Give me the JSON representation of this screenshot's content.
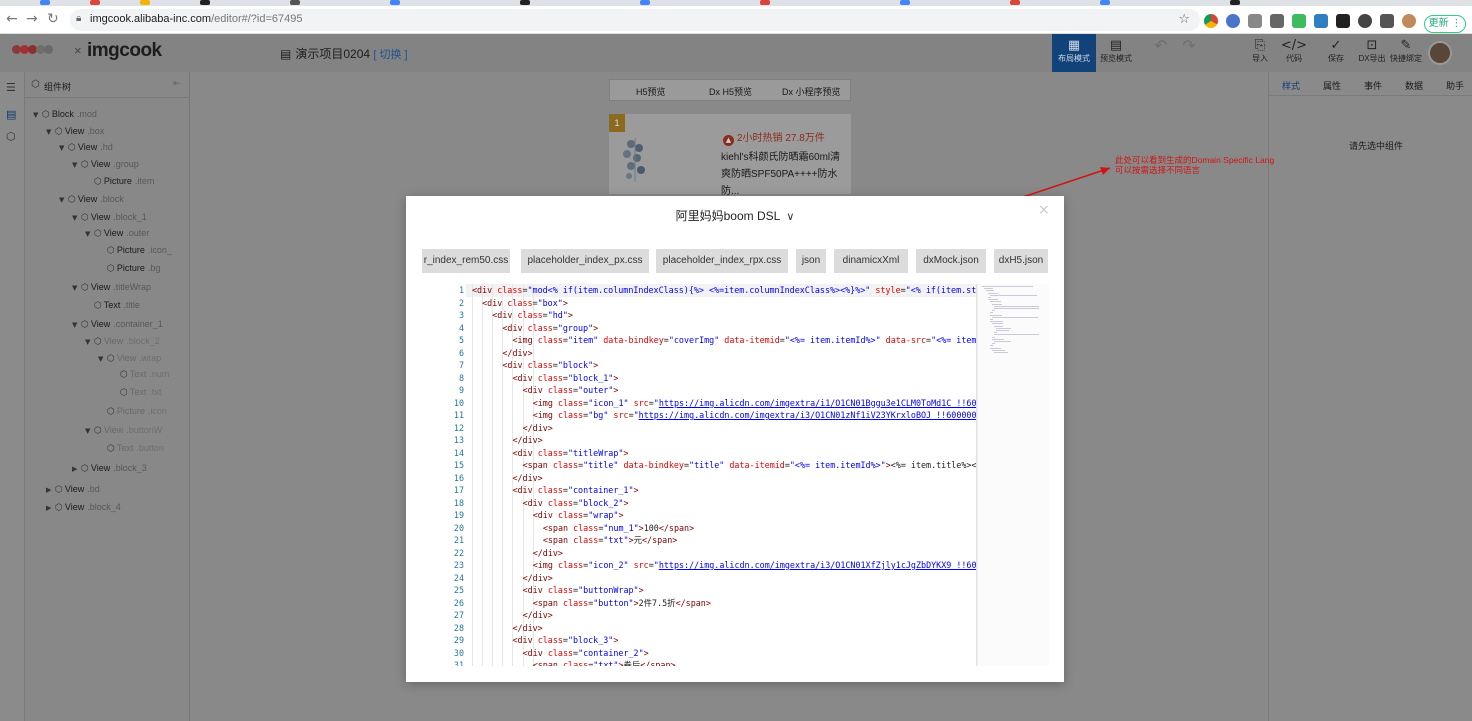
{
  "browser": {
    "url_host": "imgcook.alibaba-inc.com",
    "url_path": "/editor#/?id=67495",
    "update_label": "更新",
    "update_dots": "⋮"
  },
  "app": {
    "logo_text": "imgcook",
    "logo_x": "×",
    "project_name": "演示项目0204",
    "switch_label": "[ 切换 ]",
    "header_buttons": [
      {
        "label": "布局模式",
        "icon": "layout-icon"
      },
      {
        "label": "预览模式",
        "icon": "preview-icon"
      },
      {
        "label": "导入",
        "icon": "import-icon"
      },
      {
        "label": "代码",
        "icon": "code-icon"
      },
      {
        "label": "保存",
        "icon": "save-icon"
      },
      {
        "label": "DX导出",
        "icon": "export-icon"
      },
      {
        "label": "快捷绑定",
        "icon": "bind-icon"
      }
    ]
  },
  "tree": {
    "title": "组件树",
    "rows": [
      {
        "name": "Block",
        "cls": ".mod"
      },
      {
        "name": "View",
        "cls": ".box"
      },
      {
        "name": "View",
        "cls": ".hd"
      },
      {
        "name": "View",
        "cls": ".group"
      },
      {
        "name": "Picture",
        "cls": ".item"
      },
      {
        "name": "View",
        "cls": ".block"
      },
      {
        "name": "View",
        "cls": ".block_1"
      },
      {
        "name": "View",
        "cls": ".outer"
      },
      {
        "name": "Picture",
        "cls": ".icon_"
      },
      {
        "name": "Picture",
        "cls": ".bg"
      },
      {
        "name": "View",
        "cls": ".titleWrap"
      },
      {
        "name": "Text",
        "cls": ".title"
      },
      {
        "name": "View",
        "cls": ".container_1"
      },
      {
        "name": "View",
        "cls": ".block_2"
      },
      {
        "name": "View",
        "cls": ".wrap"
      },
      {
        "name": "Text",
        "cls": ".num"
      },
      {
        "name": "Text",
        "cls": ".txt"
      },
      {
        "name": "Picture",
        "cls": ".icon"
      },
      {
        "name": "View",
        "cls": ".buttonW"
      },
      {
        "name": "Text",
        "cls": ".button"
      },
      {
        "name": "View",
        "cls": ".block_3"
      },
      {
        "name": "View",
        "cls": ".bd"
      },
      {
        "name": "View",
        "cls": ".block_4"
      }
    ]
  },
  "preview": {
    "tabs": [
      "H5预览",
      "Dx H5预览",
      "Dx 小程序预览"
    ],
    "badge": "1",
    "hot": "2小时热销 27.8万件",
    "title": "kiehl's科颜氏防晒霜60ml清爽防晒SPF50PA++++防水防..."
  },
  "right_panel": {
    "tabs": [
      "样式",
      "属性",
      "事件",
      "数据",
      "助手"
    ],
    "empty": "请先选中组件"
  },
  "annotation": {
    "text": "此处可以看到生成的Domain Specific Lang 可以按需选择不同语言"
  },
  "modal": {
    "title": "阿里妈妈boom DSL",
    "close": "×",
    "file_tabs": [
      "r_index_rem50.css",
      "placeholder_index_px.css",
      "placeholder_index_rpx.css",
      "json",
      "dinamicxXml",
      "dxMock.json",
      "dxH5.json"
    ],
    "code_lines": [
      [
        [
          "t",
          "<div "
        ],
        [
          "a",
          "class"
        ],
        [
          "p",
          "="
        ],
        [
          "v",
          "\"mod<% if(item.columnIndexClass){%> <%=item.columnIndexClass%><%}%>\""
        ],
        [
          "p",
          " "
        ],
        [
          "a",
          "style"
        ],
        [
          "p",
          "="
        ],
        [
          "v",
          "\"<% if(item.styl"
        ]
      ],
      [
        [
          "t",
          "<div "
        ],
        [
          "a",
          "class"
        ],
        [
          "p",
          "="
        ],
        [
          "v",
          "\"box\""
        ],
        [
          "t",
          ">"
        ]
      ],
      [
        [
          "t",
          "<div "
        ],
        [
          "a",
          "class"
        ],
        [
          "p",
          "="
        ],
        [
          "v",
          "\"hd\""
        ],
        [
          "t",
          ">"
        ]
      ],
      [
        [
          "t",
          "<div "
        ],
        [
          "a",
          "class"
        ],
        [
          "p",
          "="
        ],
        [
          "v",
          "\"group\""
        ],
        [
          "t",
          ">"
        ]
      ],
      [
        [
          "t",
          "<img "
        ],
        [
          "a",
          "class"
        ],
        [
          "p",
          "="
        ],
        [
          "v",
          "\"item\""
        ],
        [
          "p",
          " "
        ],
        [
          "a",
          "data-bindkey"
        ],
        [
          "p",
          "="
        ],
        [
          "v",
          "\"coverImg\""
        ],
        [
          "p",
          " "
        ],
        [
          "a",
          "data-itemid"
        ],
        [
          "p",
          "="
        ],
        [
          "v",
          "\"<%= item.itemId%>\""
        ],
        [
          "p",
          " "
        ],
        [
          "a",
          "data-src"
        ],
        [
          "p",
          "="
        ],
        [
          "v",
          "\"<%= item.c"
        ]
      ],
      [
        [
          "t",
          "</div>"
        ]
      ],
      [
        [
          "t",
          "<div "
        ],
        [
          "a",
          "class"
        ],
        [
          "p",
          "="
        ],
        [
          "v",
          "\"block\""
        ],
        [
          "t",
          ">"
        ]
      ],
      [
        [
          "t",
          "<div "
        ],
        [
          "a",
          "class"
        ],
        [
          "p",
          "="
        ],
        [
          "v",
          "\"block_1\""
        ],
        [
          "t",
          ">"
        ]
      ],
      [
        [
          "t",
          "<div "
        ],
        [
          "a",
          "class"
        ],
        [
          "p",
          "="
        ],
        [
          "v",
          "\"outer\""
        ],
        [
          "t",
          ">"
        ]
      ],
      [
        [
          "t",
          "<img "
        ],
        [
          "a",
          "class"
        ],
        [
          "p",
          "="
        ],
        [
          "v",
          "\"icon_1\""
        ],
        [
          "p",
          " "
        ],
        [
          "a",
          "src"
        ],
        [
          "p",
          "="
        ],
        [
          "v",
          "\""
        ],
        [
          "u",
          "https://img.alicdn.com/imgextra/i1/O1CN01Bggu3e1CLM0ToMd1C_!!6000"
        ]
      ],
      [
        [
          "t",
          "<img "
        ],
        [
          "a",
          "class"
        ],
        [
          "p",
          "="
        ],
        [
          "v",
          "\"bg\""
        ],
        [
          "p",
          " "
        ],
        [
          "a",
          "src"
        ],
        [
          "p",
          "="
        ],
        [
          "v",
          "\""
        ],
        [
          "u",
          "https://img.alicdn.com/imgextra/i3/O1CN01zNf1iV23YKrxloBOJ_!!60000000"
        ]
      ],
      [
        [
          "t",
          "</div>"
        ]
      ],
      [
        [
          "t",
          "</div>"
        ]
      ],
      [
        [
          "t",
          "<div "
        ],
        [
          "a",
          "class"
        ],
        [
          "p",
          "="
        ],
        [
          "v",
          "\"titleWrap\""
        ],
        [
          "t",
          ">"
        ]
      ],
      [
        [
          "t",
          "<span "
        ],
        [
          "a",
          "class"
        ],
        [
          "p",
          "="
        ],
        [
          "v",
          "\"title\""
        ],
        [
          "p",
          " "
        ],
        [
          "a",
          "data-bindkey"
        ],
        [
          "p",
          "="
        ],
        [
          "v",
          "\"title\""
        ],
        [
          "p",
          " "
        ],
        [
          "a",
          "data-itemid"
        ],
        [
          "p",
          "="
        ],
        [
          "v",
          "\"<%= item.itemId%>\""
        ],
        [
          "t",
          ">"
        ],
        [
          "p",
          "<%= item.title%></s"
        ]
      ],
      [
        [
          "t",
          "</div>"
        ]
      ],
      [
        [
          "t",
          "<div "
        ],
        [
          "a",
          "class"
        ],
        [
          "p",
          "="
        ],
        [
          "v",
          "\"container_1\""
        ],
        [
          "t",
          ">"
        ]
      ],
      [
        [
          "t",
          "<div "
        ],
        [
          "a",
          "class"
        ],
        [
          "p",
          "="
        ],
        [
          "v",
          "\"block_2\""
        ],
        [
          "t",
          ">"
        ]
      ],
      [
        [
          "t",
          "<div "
        ],
        [
          "a",
          "class"
        ],
        [
          "p",
          "="
        ],
        [
          "v",
          "\"wrap\""
        ],
        [
          "t",
          ">"
        ]
      ],
      [
        [
          "t",
          "<span "
        ],
        [
          "a",
          "class"
        ],
        [
          "p",
          "="
        ],
        [
          "v",
          "\"num_1\""
        ],
        [
          "t",
          ">"
        ],
        [
          "p",
          "100"
        ],
        [
          "t",
          "</span>"
        ]
      ],
      [
        [
          "t",
          "<span "
        ],
        [
          "a",
          "class"
        ],
        [
          "p",
          "="
        ],
        [
          "v",
          "\"txt\""
        ],
        [
          "t",
          ">"
        ],
        [
          "p",
          "元"
        ],
        [
          "t",
          "</span>"
        ]
      ],
      [
        [
          "t",
          "</div>"
        ]
      ],
      [
        [
          "t",
          "<img "
        ],
        [
          "a",
          "class"
        ],
        [
          "p",
          "="
        ],
        [
          "v",
          "\"icon_2\""
        ],
        [
          "p",
          " "
        ],
        [
          "a",
          "src"
        ],
        [
          "p",
          "="
        ],
        [
          "v",
          "\""
        ],
        [
          "u",
          "https://img.alicdn.com/imgextra/i3/O1CN01XfZjly1cJgZbDYKX9_!!6000"
        ]
      ],
      [
        [
          "t",
          "</div>"
        ]
      ],
      [
        [
          "t",
          "<div "
        ],
        [
          "a",
          "class"
        ],
        [
          "p",
          "="
        ],
        [
          "v",
          "\"buttonWrap\""
        ],
        [
          "t",
          ">"
        ]
      ],
      [
        [
          "t",
          "<span "
        ],
        [
          "a",
          "class"
        ],
        [
          "p",
          "="
        ],
        [
          "v",
          "\"button\""
        ],
        [
          "t",
          ">"
        ],
        [
          "p",
          "2件7.5折"
        ],
        [
          "t",
          "</span>"
        ]
      ],
      [
        [
          "t",
          "</div>"
        ]
      ],
      [
        [
          "t",
          "</div>"
        ]
      ],
      [
        [
          "t",
          "<div "
        ],
        [
          "a",
          "class"
        ],
        [
          "p",
          "="
        ],
        [
          "v",
          "\"block_3\""
        ],
        [
          "t",
          ">"
        ]
      ],
      [
        [
          "t",
          "<div "
        ],
        [
          "a",
          "class"
        ],
        [
          "p",
          "="
        ],
        [
          "v",
          "\"container_2\""
        ],
        [
          "t",
          ">"
        ]
      ],
      [
        [
          "t",
          "<span "
        ],
        [
          "a",
          "class"
        ],
        [
          "p",
          "="
        ],
        [
          "v",
          "\"txt\""
        ],
        [
          "t",
          ">"
        ],
        [
          "p",
          "券后"
        ],
        [
          "t",
          "</span>"
        ]
      ]
    ]
  },
  "colors": {
    "accent": "#11427a",
    "annotation": "#d21414",
    "tag": "#800000",
    "attr": "#e50000",
    "value": "#0000ff",
    "line_number": "#237893"
  }
}
